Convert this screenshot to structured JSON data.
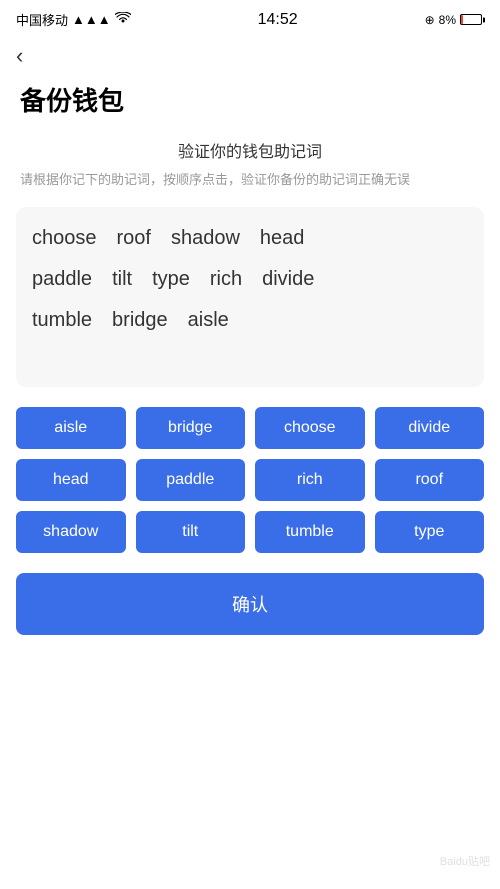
{
  "statusBar": {
    "carrier": "中国移动",
    "time": "14:52",
    "batteryPercent": "8%",
    "icons": {
      "signal": "📶",
      "wifi": "WiFi"
    }
  },
  "backLabel": "‹",
  "pageTitle": "备份钱包",
  "sectionTitle": "验证你的钱包助记词",
  "description": "请根据你记下的助记词，按顺序点击，验证你备份的助记词正确无误",
  "wordGrid": {
    "rows": [
      [
        "choose",
        "roof",
        "shadow",
        "head"
      ],
      [
        "paddle",
        "tilt",
        "type",
        "rich",
        "divide"
      ],
      [
        "tumble",
        "bridge",
        "aisle"
      ]
    ]
  },
  "wordButtons": [
    "aisle",
    "bridge",
    "choose",
    "divide",
    "head",
    "paddle",
    "rich",
    "roof",
    "shadow",
    "tilt",
    "tumble",
    "type"
  ],
  "confirmLabel": "确认",
  "watermark": "Baidu贴吧"
}
